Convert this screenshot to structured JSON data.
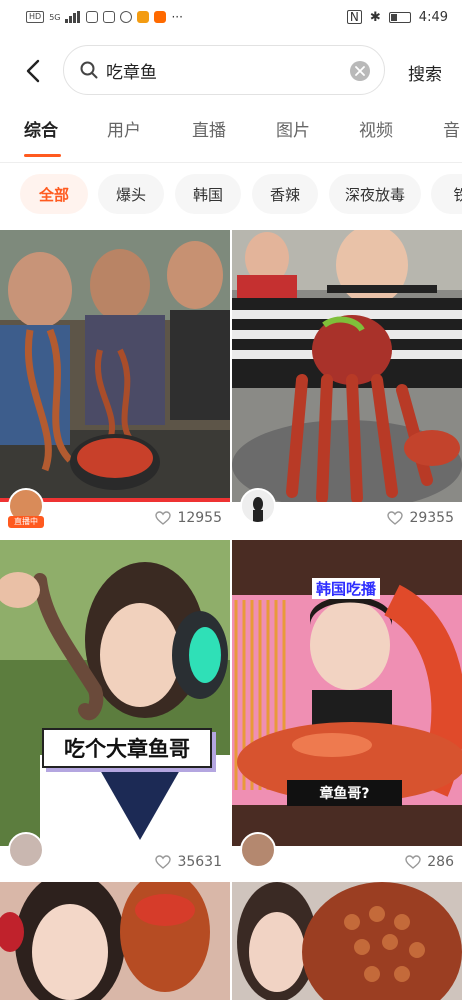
{
  "status_bar": {
    "left_tags": [
      "HD",
      "5G"
    ],
    "time": "4:49"
  },
  "search": {
    "back_icon": "chevron-left-icon",
    "query": "吃章鱼",
    "search_label": "搜索"
  },
  "tabs": [
    "综合",
    "用户",
    "直播",
    "图片",
    "视频",
    "音"
  ],
  "active_tab": "综合",
  "chips": [
    "全部",
    "爆头",
    "韩国",
    "香辣",
    "深夜放毒",
    "铁"
  ],
  "active_chip": "全部",
  "colors": {
    "accent": "#ff5a1f"
  },
  "cards": [
    {
      "likes": "12955",
      "live_badge": "直播中",
      "overlay_text": ""
    },
    {
      "likes": "29355",
      "live_badge": "",
      "overlay_text": ""
    },
    {
      "likes": "35631",
      "live_badge": "",
      "overlay_text": "吃个大章鱼哥"
    },
    {
      "likes": "286",
      "live_badge": "",
      "overlay_top": "韩国吃播",
      "overlay_text": "章鱼哥?"
    }
  ]
}
